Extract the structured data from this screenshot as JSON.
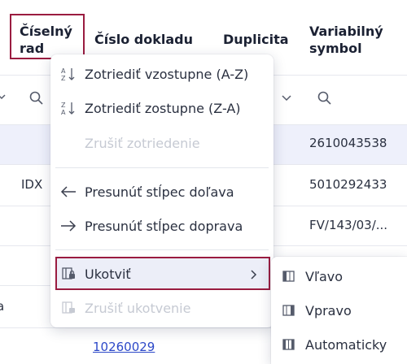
{
  "columns": {
    "ciselny_rad_line1": "Číselný",
    "ciselny_rad_line2": "rad",
    "cislo_dokladu": "Číslo dokladu",
    "duplicita": "Duplicita",
    "variabilny_line1": "Variabilný",
    "variabilny_line2": "symbol"
  },
  "rows": [
    {
      "col1": "",
      "variabilny": "2610043538"
    },
    {
      "col1": "IDX",
      "variabilny": "5010292433"
    },
    {
      "col1": "",
      "variabilny": "FV/143/03/..."
    },
    {
      "col1": "",
      "variabilny": ""
    },
    {
      "col1": "a",
      "variabilny": ""
    },
    {
      "col1": "",
      "cislo_dokladu": "10260029"
    }
  ],
  "menu": {
    "sort_asc": "Zotriediť vzostupne (A-Z)",
    "sort_desc": "Zotriediť zostupne (Z-A)",
    "sort_clear": "Zrušiť zotriedenie",
    "move_left": "Presunúť stĺpec doľava",
    "move_right": "Presunúť stĺpec doprava",
    "pin": "Ukotviť",
    "unpin": "Zrušiť ukotvenie"
  },
  "submenu": {
    "left": "Vľavo",
    "right": "Vpravo",
    "auto": "Automaticky"
  },
  "colors": {
    "highlight": "#9a1c40",
    "link": "#2c48c8",
    "selected_row": "#eef0fb"
  }
}
